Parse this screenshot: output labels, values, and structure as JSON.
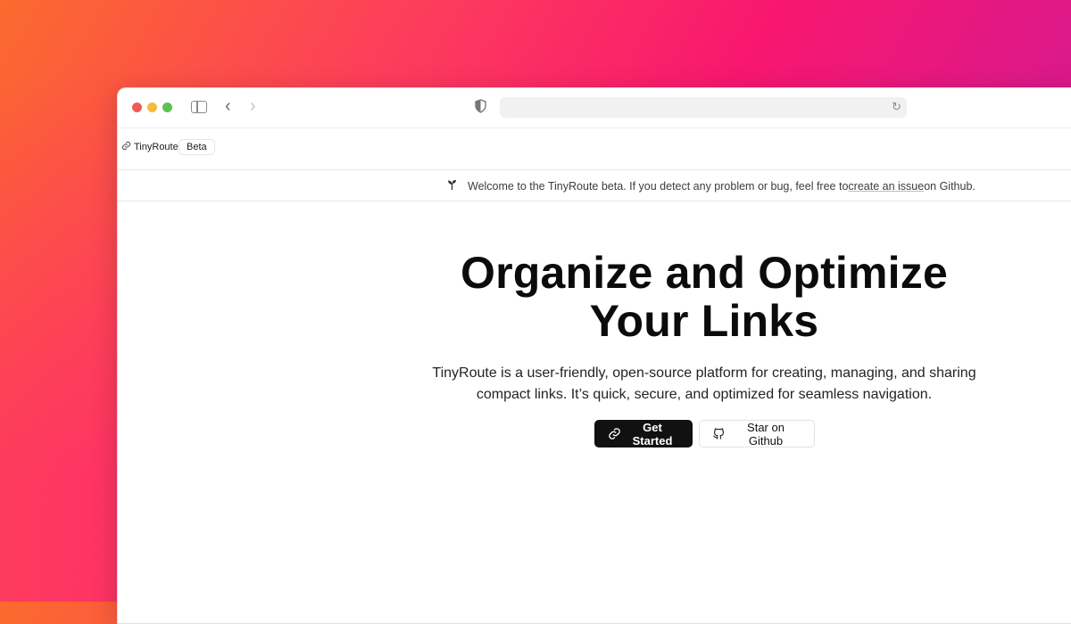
{
  "appbar": {
    "logo_icon": "link-icon",
    "logo_text": "TinyRoute",
    "badge": "Beta"
  },
  "banner": {
    "icon": "sprout-icon",
    "text_before": "Welcome to the TinyRoute beta. If you detect any problem or bug, feel free to ",
    "link": "create an issue",
    "text_after": " on Github."
  },
  "hero": {
    "title_line1": "Organize and Optimize",
    "title_line2": "Your Links",
    "subtitle": "TinyRoute is a user-friendly, open-source platform for creating, managing, and sharing compact links. It’s quick, secure, and optimized for seamless navigation.",
    "primary_button": "Get Started",
    "secondary_button": "Star on Github"
  },
  "colors": {
    "background_gradient": [
      "#fb6a2e",
      "#f8176f",
      "#b01fb5"
    ],
    "primary_button_bg": "#111111",
    "page_bg": "#ffffff"
  }
}
